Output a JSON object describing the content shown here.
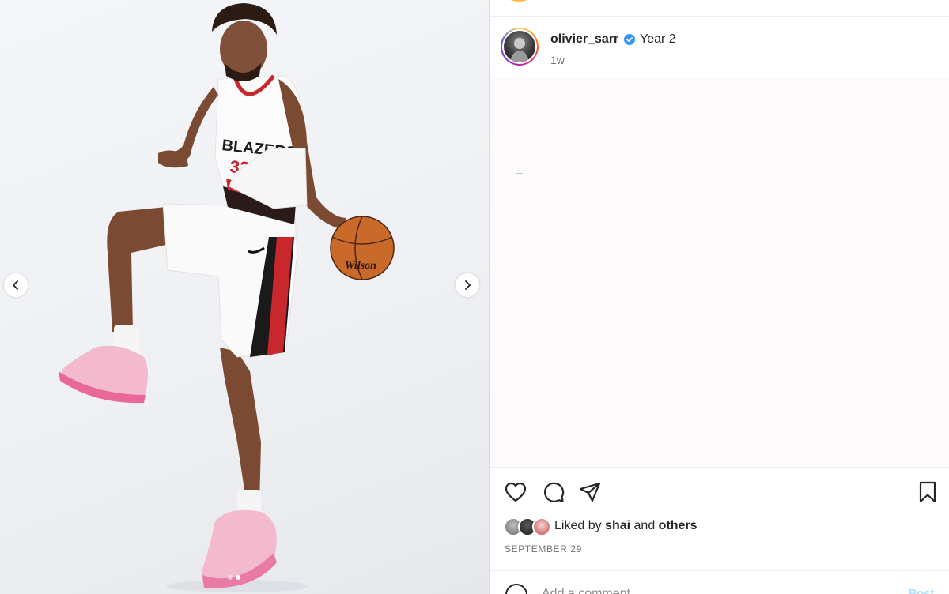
{
  "post": {
    "username": "olivier_sarr",
    "caption": "Year 2",
    "time_ago": "1w",
    "verified": true
  },
  "media": {
    "jersey_text": "BLAZERS",
    "jersey_number": "33",
    "ball_brand": "Wilson",
    "carousel": {
      "count": 2,
      "active": 1
    }
  },
  "actions": {
    "icons": [
      "heart-icon",
      "comment-icon",
      "share-icon",
      "bookmark-icon"
    ]
  },
  "likes": {
    "prefix": "Liked by",
    "first_user": "shai",
    "connector": "and",
    "others": "others"
  },
  "date": "SEPTEMBER 29",
  "comment": {
    "placeholder": "Add a comment...",
    "post_label": "Post"
  },
  "colors": {
    "verified": "#3897f0",
    "post_button_disabled": "#b2dffc",
    "text": "#262626",
    "muted": "#737373"
  }
}
